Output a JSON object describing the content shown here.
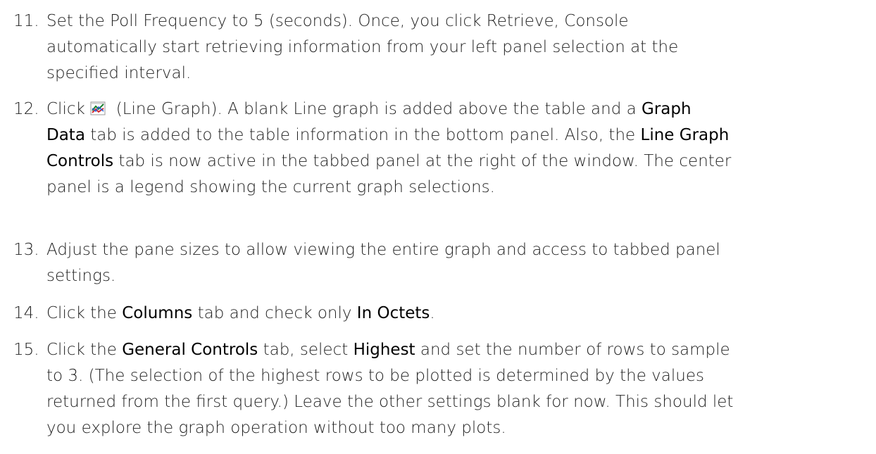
{
  "steps": [
    {
      "number": "11.",
      "lines": [
        [
          {
            "t": "Set the Poll Frequency to 5 (seconds). Once, you click Retrieve, Console"
          }
        ],
        [
          {
            "t": "automatically start retrieving information from your left panel selection at the"
          }
        ],
        [
          {
            "t": "specified interval."
          }
        ]
      ]
    },
    {
      "number": "12.",
      "icon": "line-graph-icon",
      "lines": [
        [
          {
            "t": "Click "
          },
          {
            "icon": "line-graph-icon"
          },
          {
            "t": "  (Line Graph). A blank Line graph is added above the table and a "
          },
          {
            "t": "Graph",
            "b": true
          }
        ],
        [
          {
            "t": "Data",
            "b": true
          },
          {
            "t": " tab is added to the table information in the bottom panel. Also, the "
          },
          {
            "t": "Line Graph",
            "b": true
          }
        ],
        [
          {
            "t": "Controls",
            "b": true
          },
          {
            "t": " tab is now active in the tabbed panel at the right of the window. The center"
          }
        ],
        [
          {
            "t": "panel is a legend showing the current graph selections."
          }
        ]
      ]
    },
    {
      "number": "13.",
      "lines": [
        [
          {
            "t": "Adjust the pane sizes to allow viewing the entire graph and access to tabbed panel"
          }
        ],
        [
          {
            "t": "settings."
          }
        ]
      ]
    },
    {
      "number": "14.",
      "lines": [
        [
          {
            "t": "Click the "
          },
          {
            "t": "Columns",
            "b": true
          },
          {
            "t": " tab and check only "
          },
          {
            "t": "In Octets",
            "b": true
          },
          {
            "t": "."
          }
        ]
      ]
    },
    {
      "number": "15.",
      "lines": [
        [
          {
            "t": "Click the "
          },
          {
            "t": "General Controls",
            "b": true
          },
          {
            "t": " tab, select "
          },
          {
            "t": "Highest",
            "b": true
          },
          {
            "t": " and set the number of rows to sample"
          }
        ],
        [
          {
            "t": "to 3. (The selection of the highest rows to be plotted is determined by the values"
          }
        ],
        [
          {
            "t": "returned from the first query.) Leave the other settings blank for now. This should let"
          }
        ],
        [
          {
            "t": "you explore the graph operation without too many plots."
          }
        ]
      ]
    }
  ]
}
